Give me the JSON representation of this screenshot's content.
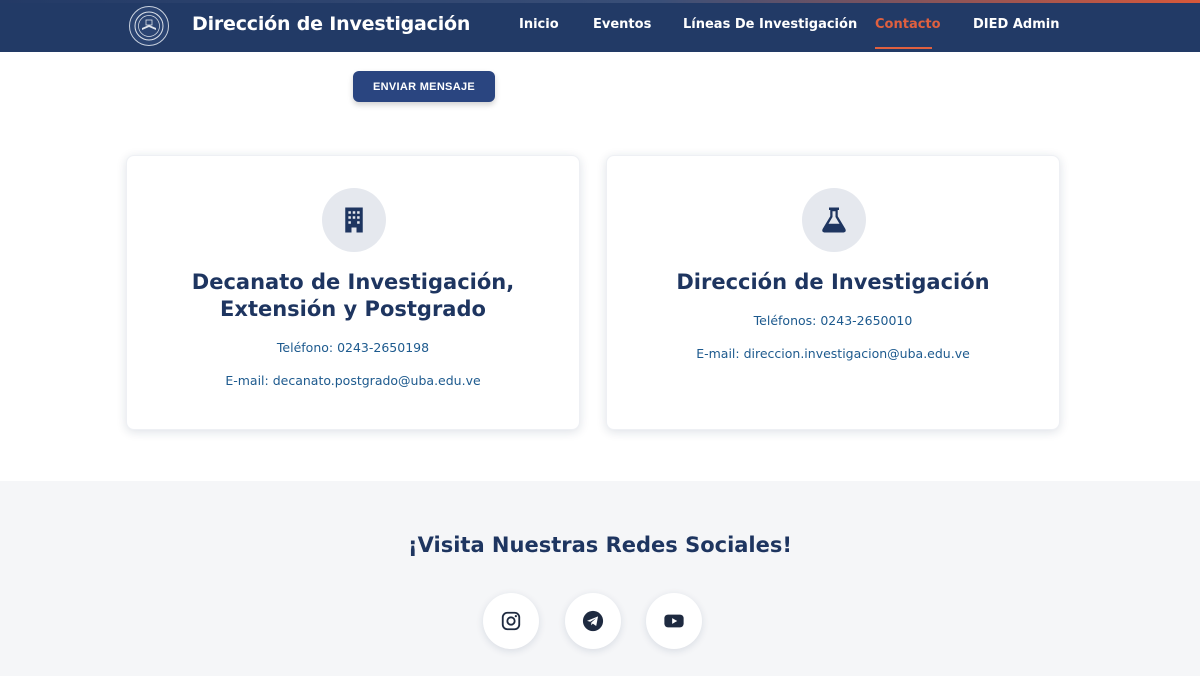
{
  "header": {
    "brand": "Dirección de Investigación",
    "logo_icon": "university-seal-icon",
    "nav": [
      {
        "label": "Inicio",
        "active": false
      },
      {
        "label": "Eventos",
        "active": false
      },
      {
        "label": "Líneas De Investigación",
        "active": false
      },
      {
        "label": "Contacto",
        "active": true
      },
      {
        "label": "DIED Admin",
        "active": false
      }
    ]
  },
  "form": {
    "send_label": "ENVIAR MENSAJE"
  },
  "cards": [
    {
      "icon": "building-icon",
      "title_line1": "Decanato de Investigación,",
      "title_line2": "Extensión y Postgrado",
      "phone": "Teléfono: 0243-2650198",
      "email": "E-mail: decanato.postgrado@uba.edu.ve"
    },
    {
      "icon": "flask-icon",
      "title_line1": "Dirección de Investigación",
      "phone": "Teléfonos: 0243-2650010",
      "email": "E-mail: direccion.investigacion@uba.edu.ve"
    }
  ],
  "social": {
    "title": "¡Visita Nuestras Redes Sociales!",
    "links": [
      {
        "icon": "instagram-icon"
      },
      {
        "icon": "telegram-icon"
      },
      {
        "icon": "youtube-icon"
      }
    ]
  },
  "colors": {
    "primary": "#223a66",
    "accent": "#e0603f",
    "link": "#1d5a8e"
  }
}
